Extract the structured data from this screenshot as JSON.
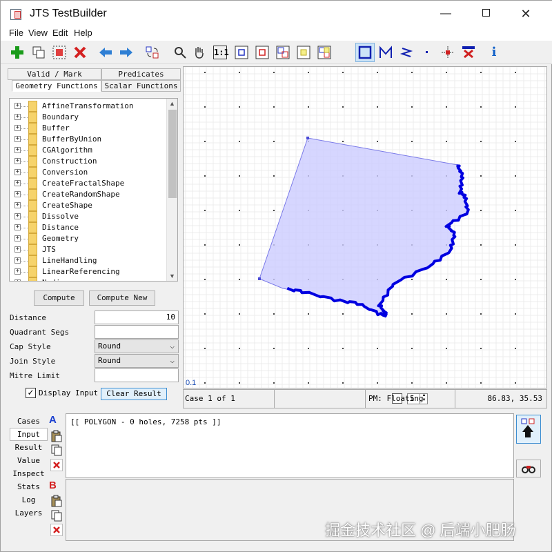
{
  "window": {
    "title": "JTS TestBuilder",
    "min_glyph": "—",
    "close_glyph": "✕"
  },
  "menu": [
    "File",
    "View",
    "Edit",
    "Help"
  ],
  "toolbar": {
    "icons": [
      "add-case-icon",
      "copy-case-icon",
      "select-all-icon",
      "delete-case-icon",
      "previous-case-icon",
      "next-case-icon",
      "swap-geometry-icon",
      "zoom-icon",
      "pan-icon",
      "zoom-1to1-icon",
      "zoom-to-a-icon",
      "zoom-to-b-icon",
      "zoom-to-input-icon",
      "zoom-to-result-icon",
      "zoom-to-full-icon",
      "draw-polygon-icon",
      "draw-linestring-icon",
      "draw-zigzag-icon",
      "draw-point-icon",
      "edit-vertex-icon",
      "delete-vertex-icon",
      "info-icon"
    ],
    "zoom_1to1_label": "1:1",
    "info_label": "i"
  },
  "left_tabs": {
    "valid_mark": "Valid / Mark",
    "predicates": "Predicates",
    "geometry_functions": "Geometry Functions",
    "scalar_functions": "Scalar Functions"
  },
  "functions": [
    "AffineTransformation",
    "Boundary",
    "Buffer",
    "BufferByUnion",
    "CGAlgorithm",
    "Construction",
    "Conversion",
    "CreateFractalShape",
    "CreateRandomShape",
    "CreateShape",
    "Dissolve",
    "Distance",
    "Geometry",
    "JTS",
    "LineHandling",
    "LinearReferencing",
    "Noding"
  ],
  "expander_glyph": "+",
  "buttons": {
    "compute": "Compute",
    "compute_new": "Compute New",
    "clear_result": "Clear Result"
  },
  "params": {
    "distance_label": "Distance",
    "distance_value": "10",
    "quadrant_segs_label": "Quadrant Segs",
    "quadrant_segs_value": "",
    "cap_style_label": "Cap Style",
    "cap_style_value": "Round",
    "join_style_label": "Join Style",
    "join_style_value": "Round",
    "mitre_limit_label": "Mitre Limit",
    "mitre_limit_value": ""
  },
  "display_input": {
    "label": "Display Input",
    "checked_glyph": "✓"
  },
  "canvas": {
    "scale_label": "0.1",
    "geometry_fill": "#ccccff",
    "geometry_stroke": "#0000e0"
  },
  "status": {
    "case": "Case 1 of 1",
    "stepper_value": "5",
    "pm": "PM: Floating",
    "coords": "86.83, 35.53"
  },
  "bottom": {
    "tabs": [
      "Cases",
      "Input",
      "Result",
      "Value",
      "Inspect",
      "Stats",
      "Log",
      "Layers"
    ],
    "letter_a": "A",
    "letter_b": "B",
    "wkt_a": "[[ POLYGON - 0 holes, 7258 pts ]]"
  },
  "watermark": "掘金技术社区 @ 后端小肥肠"
}
